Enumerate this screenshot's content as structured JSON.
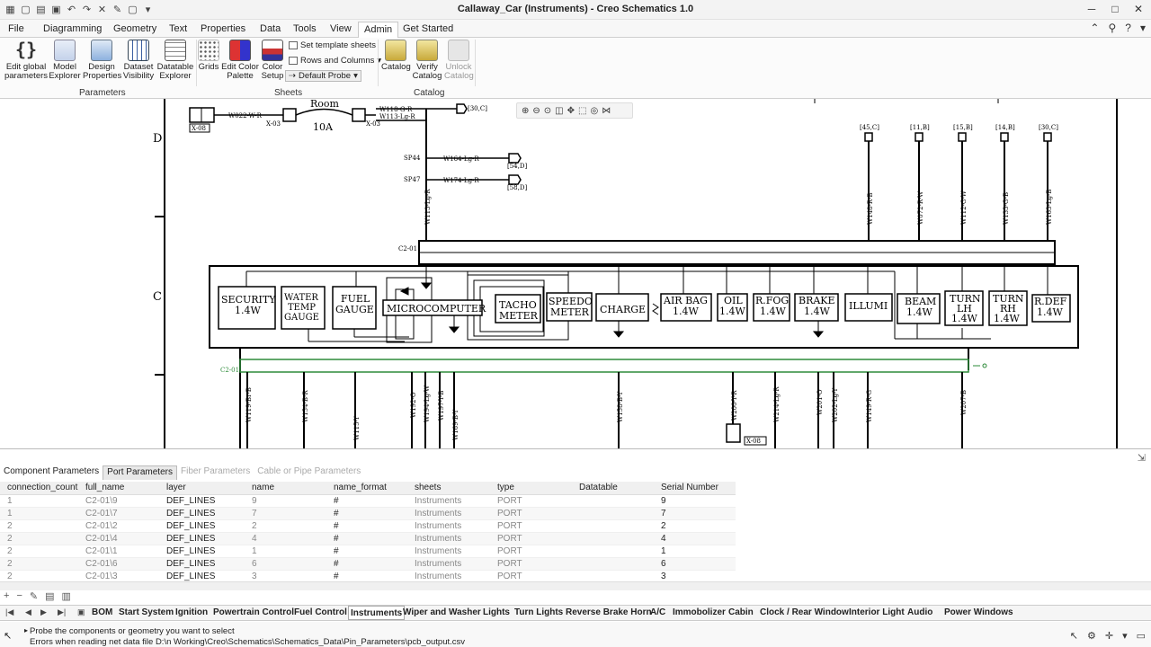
{
  "window": {
    "title": "Callaway_Car (Instruments) - Creo Schematics 1.0"
  },
  "menu": {
    "tabs": [
      "File",
      "Diagramming",
      "Geometry",
      "Text",
      "Properties",
      "Data",
      "Tools",
      "View",
      "Admin",
      "Get Started"
    ],
    "active": "Admin"
  },
  "ribbon": {
    "parameters": {
      "label": "Parameters",
      "buttons": [
        "Edit global parameters",
        "Model Explorer",
        "Design Properties",
        "Dataset Visibility",
        "Datatable Explorer"
      ]
    },
    "sheets": {
      "label": "Sheets",
      "buttons": [
        "Grids",
        "Edit Color Palette",
        "Color Setup"
      ],
      "small": [
        "Set template sheets",
        "Rows and Columns",
        "Default Probe"
      ]
    },
    "catalog": {
      "label": "Catalog",
      "buttons": [
        "Catalog",
        "Verify Catalog",
        "Unlock Catalog"
      ]
    }
  },
  "schematic": {
    "row_labels": [
      "D",
      "C"
    ],
    "modules": [
      {
        "name": "SECURITY",
        "rating": "1.4W"
      },
      {
        "name": "WATER TEMP GAUGE"
      },
      {
        "name": "FUEL GAUGE"
      },
      {
        "name": "MICROCOMPUTER"
      },
      {
        "name": "TACHO METER"
      },
      {
        "name": "SPEEDO METER"
      },
      {
        "name": "CHARGE"
      },
      {
        "name": "AIR BAG",
        "rating": "1.4W"
      },
      {
        "name": "OIL",
        "rating": "1.4W"
      },
      {
        "name": "R.FOG",
        "rating": "1.4W"
      },
      {
        "name": "BRAKE",
        "rating": "1.4W"
      },
      {
        "name": "ILLUMI"
      },
      {
        "name": "BEAM",
        "rating": "1.4W"
      },
      {
        "name": "TURN LH",
        "rating": "1.4W"
      },
      {
        "name": "TURN RH",
        "rating": "1.4W"
      },
      {
        "name": "R.DEF",
        "rating": "1.4W"
      }
    ],
    "room": "Room",
    "fuse": "10A",
    "connector_top": "C2-01",
    "connector_bottom": "C2-01",
    "refs": [
      "X-08",
      "X-03",
      "X-03",
      "X-08"
    ],
    "splices": [
      "SP44",
      "SP47"
    ],
    "wires_top": [
      "W022-W-R",
      "W118-G-R",
      "W113-Lg-R",
      "W164-Lg-R",
      "W174-Lg-R",
      "W113-Lg-R"
    ],
    "wires_right": [
      "W148-R-B",
      "W072-R-W",
      "W112-G-W",
      "W133-G-B",
      "W163-Lg-B"
    ],
    "wire_refs_right": [
      "[45,C]",
      "[11,B]",
      "[15,B]",
      "[14,B]",
      "[30,C]"
    ],
    "wire_refs": [
      "[30,C]",
      "[54,D]",
      "[58,D]"
    ],
    "wires_bottom": [
      "W119-Br-B",
      "W154-B-R",
      "W115-Y",
      "W192-O",
      "W194-Lg-W",
      "W197-Y-B",
      "W169-B-Y",
      "W158-B-Y",
      "W200-Y-R",
      "W214-Lg-R",
      "W201-O",
      "W202-Lg-Y",
      "W149-R-G",
      "W207-B"
    ]
  },
  "panel": {
    "tabs": [
      "Component Parameters",
      "Port Parameters",
      "Fiber Parameters",
      "Cable or Pipe Parameters"
    ],
    "active_tab": "Port Parameters",
    "columns": [
      "connection_count",
      "full_name",
      "layer",
      "name",
      "name_format",
      "sheets",
      "type",
      "Datatable",
      "Serial Number"
    ],
    "rows": [
      [
        "1",
        "C2-01\\9",
        "DEF_LINES",
        "9",
        "#",
        "Instruments",
        "PORT",
        "",
        "9"
      ],
      [
        "1",
        "C2-01\\7",
        "DEF_LINES",
        "7",
        "#",
        "Instruments",
        "PORT",
        "",
        "7"
      ],
      [
        "2",
        "C2-01\\2",
        "DEF_LINES",
        "2",
        "#",
        "Instruments",
        "PORT",
        "",
        "2"
      ],
      [
        "2",
        "C2-01\\4",
        "DEF_LINES",
        "4",
        "#",
        "Instruments",
        "PORT",
        "",
        "4"
      ],
      [
        "2",
        "C2-01\\1",
        "DEF_LINES",
        "1",
        "#",
        "Instruments",
        "PORT",
        "",
        "1"
      ],
      [
        "2",
        "C2-01\\6",
        "DEF_LINES",
        "6",
        "#",
        "Instruments",
        "PORT",
        "",
        "6"
      ],
      [
        "2",
        "C2-01\\3",
        "DEF_LINES",
        "3",
        "#",
        "Instruments",
        "PORT",
        "",
        "3"
      ]
    ]
  },
  "sheets": {
    "tabs": [
      "BOM",
      "Start System",
      "Ignition",
      "Powertrain Control",
      "Fuel Control",
      "Instruments",
      "Wiper and Washer",
      "Lights",
      "Turn Lights",
      "Reverse Brake Horn",
      "A/C",
      "Immobolizer",
      "Cabin",
      "Clock / Rear Window",
      "Interior Light",
      "Audio",
      "Power Windows"
    ],
    "active": "Instruments"
  },
  "status": {
    "line1": "Probe the components or geometry you want to select",
    "line2": "Errors when reading net data file D:\\n Working\\Creo\\Schematics\\Schematics_Data\\Pin_Parameters\\pcb_output.csv"
  },
  "colors": {
    "wire": "#000000",
    "selection": "#2e8b3a",
    "accent": "#1f5fa8"
  }
}
